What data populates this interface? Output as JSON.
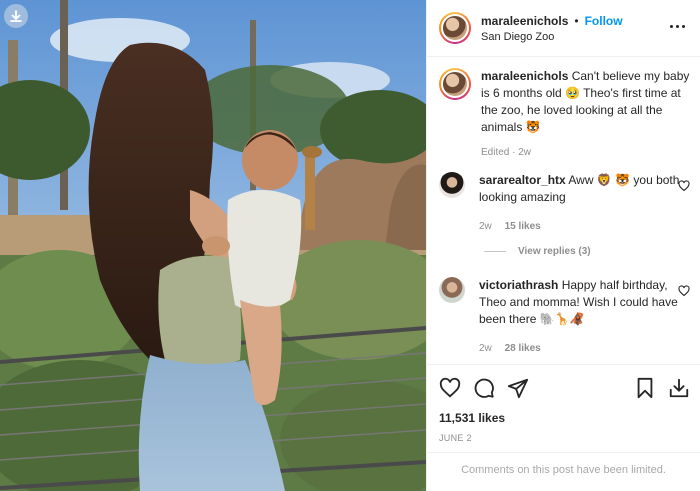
{
  "post": {
    "username": "maraleenichols",
    "follow_label": "Follow",
    "location": "San Diego Zoo",
    "caption": "Can't believe my baby is 6 months old 🥹 Theo's first time at the zoo, he loved looking at all the animals 🐯",
    "edited": "Edited · 2w"
  },
  "comments": [
    {
      "user": "sararealtor_htx",
      "text": "Aww 🦁 🐯 you both looking amazing",
      "time": "2w",
      "likes": "15 likes"
    },
    {
      "user": "victoriathrash",
      "text": "Happy half birthday, Theo and momma! Wish I could have been there 🐘🦒🦧",
      "time": "2w",
      "likes": "28 likes"
    }
  ],
  "view_replies": "View replies (3)",
  "likes_count": "11,531 likes",
  "date": "JUNE 2",
  "comments_limited": "Comments on this post have been limited."
}
